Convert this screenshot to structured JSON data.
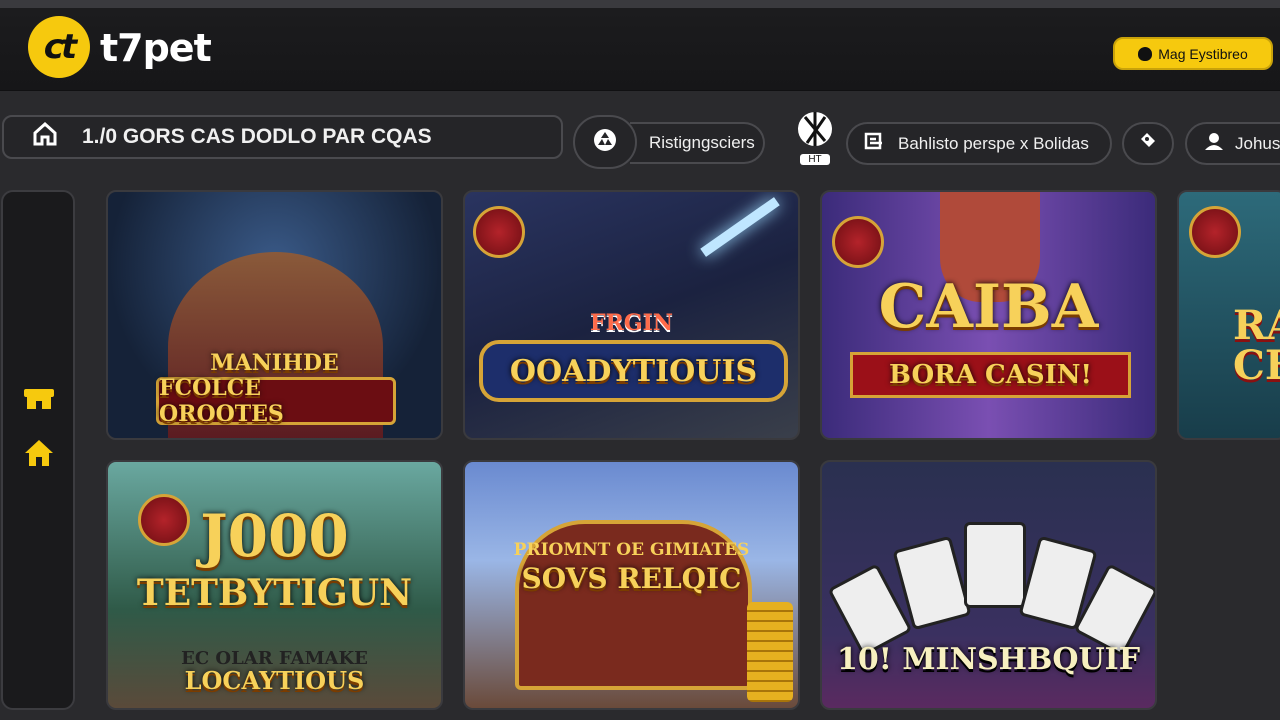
{
  "header": {
    "logo_mark": "ct",
    "logo_text": "t7pet",
    "login_label": "Mag Eystibreo"
  },
  "nav": {
    "main_label": "1./0 GORS CAS DODLO PAR CQAS",
    "item2_label": "Ristigngsciers",
    "sport_label": "HT",
    "item4_label": "Bahlisto perspe x Bolidas",
    "item6_label": "Johus"
  },
  "games": [
    {
      "top": "MANIHDE",
      "title": "FCOLCE OROOTES"
    },
    {
      "top": "FRGIN",
      "title": "OOADYTIOUIS"
    },
    {
      "top": "CAIBA",
      "title": "BORA CASIN!"
    },
    {
      "top": "RA",
      "title": "CE"
    },
    {
      "top": "J000",
      "title": "TETBYTIGUN",
      "sub1": "EC OLAR FAMAKE",
      "sub2": "LOCAYTIOUS"
    },
    {
      "top": "PRIOMNT OE GIMIATES",
      "title": "SOVS RELQIC"
    },
    {
      "top": "",
      "title": "10! MINSHBQUIF"
    }
  ],
  "colors": {
    "accent": "#f6c90e",
    "background": "#2a2a2d"
  },
  "icons": [
    "home-icon",
    "recycle-icon",
    "sport-icon",
    "ticket-icon",
    "tag-icon",
    "users-icon",
    "store-icon",
    "house-icon",
    "apple-icon"
  ]
}
